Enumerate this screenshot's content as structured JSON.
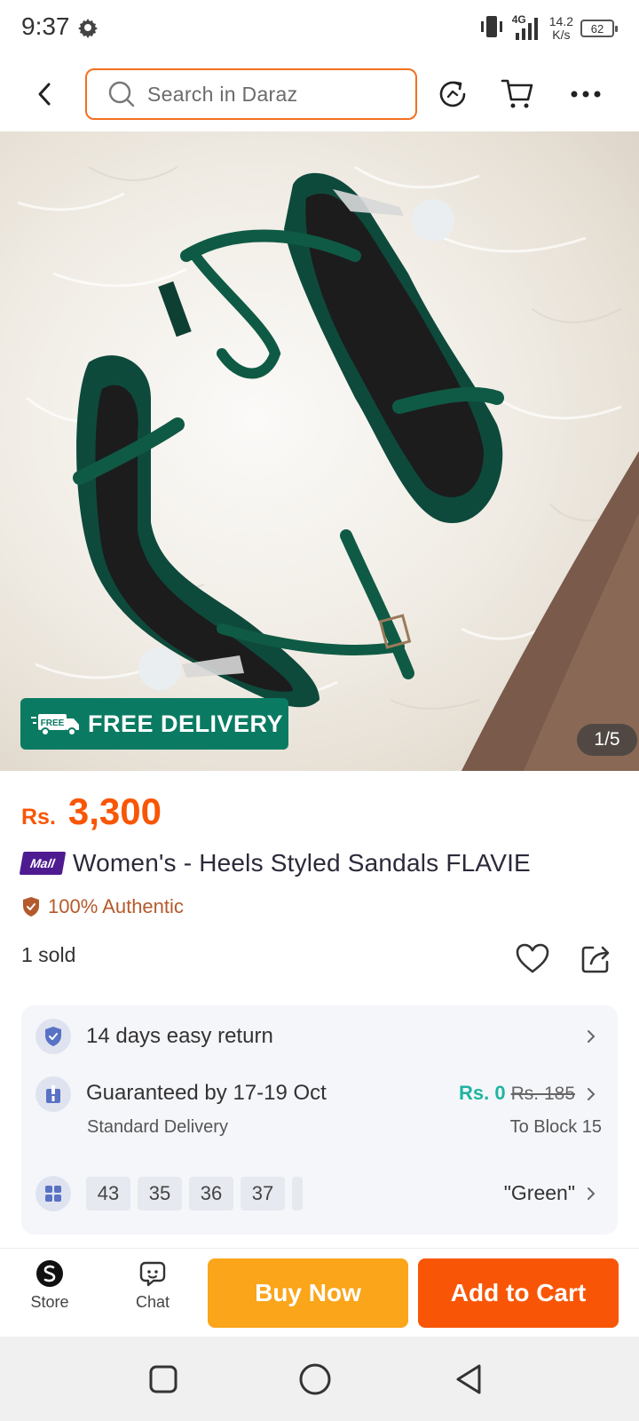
{
  "status_bar": {
    "time": "9:37",
    "network": "4G",
    "speed_value": "14.2",
    "speed_unit": "K/s",
    "battery": "62",
    "icons": [
      "gear-icon",
      "vibrate-icon",
      "signal-icon",
      "battery-icon"
    ]
  },
  "header": {
    "search_placeholder": "Search in Daraz",
    "icons": [
      "back-icon",
      "search-icon",
      "history-icon",
      "cart-icon",
      "more-icon"
    ]
  },
  "gallery": {
    "badge_text": "FREE DELIVERY",
    "truck_badge_text": "FREE",
    "counter": "1/5"
  },
  "product": {
    "currency": "Rs.",
    "price": "3,300",
    "mall_badge": "Mall",
    "title": "Women's - Heels Styled Sandals FLAVIE",
    "authentic": "100% Authentic",
    "sold": "1 sold"
  },
  "info": {
    "return_text": "14 days easy return",
    "delivery_title": "Guaranteed by 17-19 Oct",
    "delivery_type": "Standard Delivery",
    "shipping_fee": "Rs. 0",
    "shipping_old_fee": "Rs. 185",
    "destination": "To Block 15",
    "sizes": [
      "43",
      "35",
      "36",
      "37"
    ],
    "color": "\"Green\""
  },
  "actions": {
    "store_label": "Store",
    "chat_label": "Chat",
    "buy_now": "Buy Now",
    "add_to_cart": "Add to Cart"
  },
  "colors": {
    "accent": "#f85606",
    "buy_now": "#faa51a",
    "free_delivery": "#0a7b62",
    "mall": "#4e1b91",
    "free_shipping": "#1fb4a0"
  }
}
